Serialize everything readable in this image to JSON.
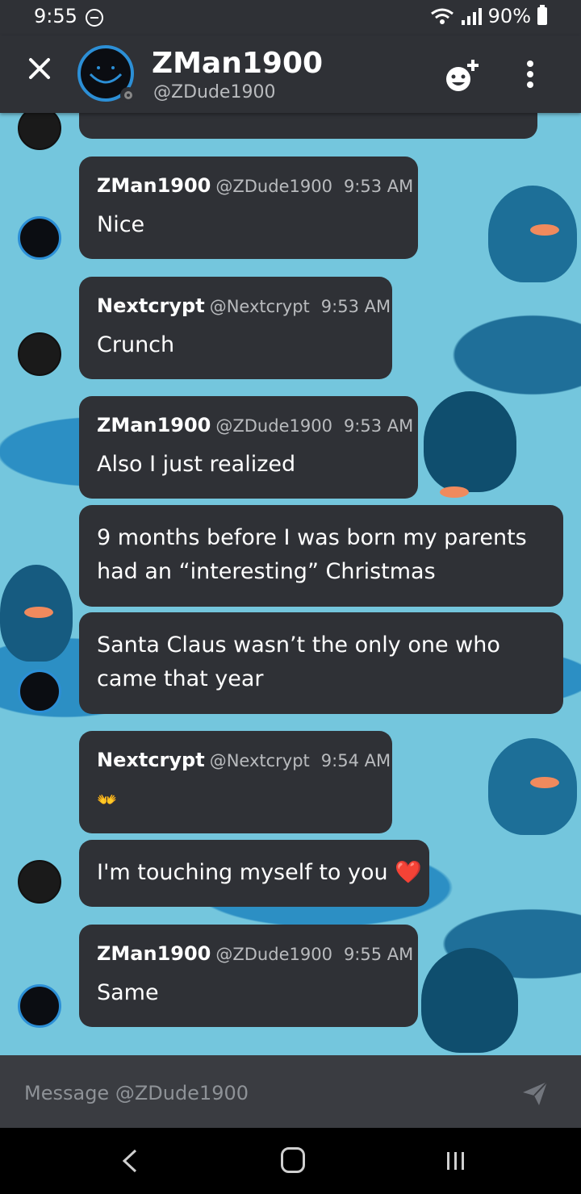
{
  "status_bar": {
    "time": "9:55",
    "battery": "90%"
  },
  "header": {
    "name": "ZMan1900",
    "handle": "@ZDude1900"
  },
  "messages": [
    {
      "author": "ZMan1900",
      "handle": "@ZDude1900",
      "time": "9:53 AM",
      "text": "Nice"
    },
    {
      "author": "Nextcrypt",
      "handle": "@Nextcrypt",
      "time": "9:53 AM",
      "text": "Crunch"
    },
    {
      "author": "ZMan1900",
      "handle": "@ZDude1900",
      "time": "9:53 AM",
      "text": "Also I just realized"
    },
    {
      "text_line1": "9 months before I was born my parents",
      "text_line2": "had an “interesting” Christmas"
    },
    {
      "text_line1": "Santa Claus wasn’t the only one who",
      "text_line2": "came that year"
    },
    {
      "author": "Nextcrypt",
      "handle": "@Nextcrypt",
      "time": "9:54 AM",
      "text": "👐"
    },
    {
      "text": "I'm touching myself to you ❤️"
    },
    {
      "author": "ZMan1900",
      "handle": "@ZDude1900",
      "time": "9:55 AM",
      "text": "Same"
    }
  ],
  "composer": {
    "placeholder": "Message @ZDude1900"
  },
  "icons": {
    "close": "close-icon",
    "add_friend": "add-friend-icon",
    "menu": "more-vertical-icon",
    "send": "send-icon",
    "back": "nav-back-icon",
    "home": "nav-home-icon",
    "recent": "nav-recent-icon"
  },
  "colors": {
    "bubble": "#2f3136",
    "header": "#2f3136",
    "background": "#74c6dd",
    "avatar_ring": "#2c8fd6"
  }
}
